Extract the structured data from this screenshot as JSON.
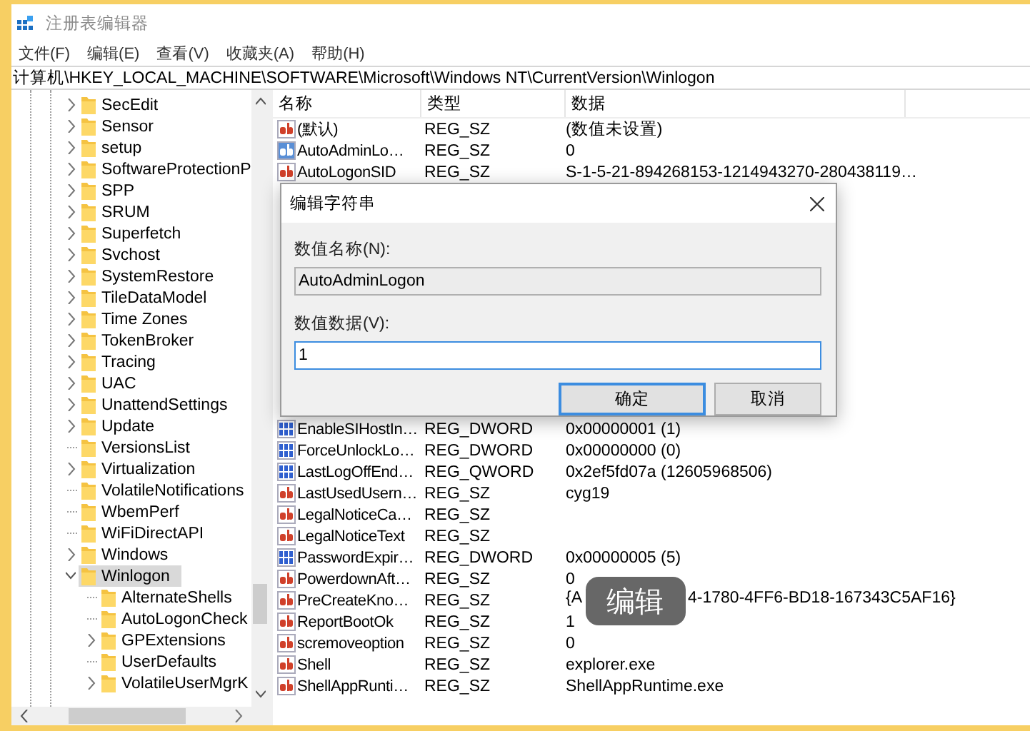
{
  "window": {
    "title": "注册表编辑器"
  },
  "menu": [
    "文件(F)",
    "编辑(E)",
    "查看(V)",
    "收藏夹(A)",
    "帮助(H)"
  ],
  "address": "计算机\\HKEY_LOCAL_MACHINE\\SOFTWARE\\Microsoft\\Windows NT\\CurrentVersion\\Winlogon",
  "tree": {
    "items": [
      {
        "label": "SecEdit",
        "kind": "collapsed",
        "selected": false
      },
      {
        "label": "Sensor",
        "kind": "collapsed",
        "selected": false
      },
      {
        "label": "setup",
        "kind": "collapsed",
        "selected": false
      },
      {
        "label": "SoftwareProtectionP",
        "kind": "collapsed",
        "selected": false
      },
      {
        "label": "SPP",
        "kind": "collapsed",
        "selected": false
      },
      {
        "label": "SRUM",
        "kind": "collapsed",
        "selected": false
      },
      {
        "label": "Superfetch",
        "kind": "collapsed",
        "selected": false
      },
      {
        "label": "Svchost",
        "kind": "collapsed",
        "selected": false
      },
      {
        "label": "SystemRestore",
        "kind": "collapsed",
        "selected": false
      },
      {
        "label": "TileDataModel",
        "kind": "collapsed",
        "selected": false
      },
      {
        "label": "Time Zones",
        "kind": "collapsed",
        "selected": false
      },
      {
        "label": "TokenBroker",
        "kind": "collapsed",
        "selected": false
      },
      {
        "label": "Tracing",
        "kind": "collapsed",
        "selected": false
      },
      {
        "label": "UAC",
        "kind": "collapsed",
        "selected": false
      },
      {
        "label": "UnattendSettings",
        "kind": "collapsed",
        "selected": false
      },
      {
        "label": "Update",
        "kind": "collapsed",
        "selected": false
      },
      {
        "label": "VersionsList",
        "kind": "leaf",
        "selected": false
      },
      {
        "label": "Virtualization",
        "kind": "collapsed",
        "selected": false
      },
      {
        "label": "VolatileNotifications",
        "kind": "leaf",
        "selected": false
      },
      {
        "label": "WbemPerf",
        "kind": "leaf",
        "selected": false
      },
      {
        "label": "WiFiDirectAPI",
        "kind": "leaf",
        "selected": false
      },
      {
        "label": "Windows",
        "kind": "collapsed",
        "selected": false
      },
      {
        "label": "Winlogon",
        "kind": "expanded",
        "selected": true,
        "children": [
          {
            "label": "AlternateShells",
            "kind": "leaf",
            "selected": false
          },
          {
            "label": "AutoLogonCheck",
            "kind": "leaf",
            "selected": false
          },
          {
            "label": "GPExtensions",
            "kind": "collapsed",
            "selected": false
          },
          {
            "label": "UserDefaults",
            "kind": "leaf",
            "selected": false
          },
          {
            "label": "VolatileUserMgrK",
            "kind": "collapsed",
            "selected": false
          }
        ]
      }
    ]
  },
  "table": {
    "columns": [
      "名称",
      "类型",
      "数据"
    ],
    "rows": [
      {
        "kind": "string",
        "name": "(默认)",
        "type": "REG_SZ",
        "data": "(数值未设置)",
        "selected": false
      },
      {
        "kind": "string",
        "name": "AutoAdminLo…",
        "type": "REG_SZ",
        "data": "0",
        "selected": true
      },
      {
        "kind": "string",
        "name": "AutoLogonSID",
        "type": "REG_SZ",
        "data": "S-1-5-21-894268153-1214943270-280438119…",
        "selected": false
      },
      {
        "kind": "binary",
        "name": "EnableSIHostIn…",
        "type": "REG_DWORD",
        "data": "0x00000001 (1)",
        "selected": false
      },
      {
        "kind": "binary",
        "name": "ForceUnlockLo…",
        "type": "REG_DWORD",
        "data": "0x00000000 (0)",
        "selected": false
      },
      {
        "kind": "binary",
        "name": "LastLogOffEnd…",
        "type": "REG_QWORD",
        "data": "0x2ef5fd07a (12605968506)",
        "selected": false
      },
      {
        "kind": "string",
        "name": "LastUsedUsern…",
        "type": "REG_SZ",
        "data": "cyg19",
        "selected": false
      },
      {
        "kind": "string",
        "name": "LegalNoticeCa…",
        "type": "REG_SZ",
        "selected": false
      },
      {
        "kind": "string",
        "name": "LegalNoticeText",
        "type": "REG_SZ",
        "selected": false
      },
      {
        "kind": "binary",
        "name": "PasswordExpir…",
        "type": "REG_DWORD",
        "data": "0x00000005 (5)",
        "selected": false
      },
      {
        "kind": "string",
        "name": "PowerdownAft…",
        "type": "REG_SZ",
        "data": "0",
        "selected": false
      },
      {
        "kind": "string",
        "name": "PreCreateKno…",
        "type": "REG_SZ",
        "data": "{A",
        "data_after": "4-1780-4FF6-BD18-167343C5AF16}",
        "selected": false
      },
      {
        "kind": "string",
        "name": "ReportBootOk",
        "type": "REG_SZ",
        "data": "1",
        "selected": false
      },
      {
        "kind": "string",
        "name": "scremoveoption",
        "type": "REG_SZ",
        "data": "0",
        "selected": false
      },
      {
        "kind": "string",
        "name": "Shell",
        "type": "REG_SZ",
        "data": "explorer.exe",
        "selected": false
      },
      {
        "kind": "string",
        "name": "ShellAppRunti…",
        "type": "REG_SZ",
        "data": "ShellAppRuntime.exe",
        "selected": false
      }
    ]
  },
  "dialog": {
    "title": "编辑字符串",
    "name_label": "数值名称(N):",
    "name_value": "AutoAdminLogon",
    "data_label": "数值数据(V):",
    "data_value": "1",
    "buttons": [
      {
        "label": "确定",
        "default": true
      },
      {
        "label": "取消",
        "default": false
      }
    ]
  },
  "toast": "编辑"
}
